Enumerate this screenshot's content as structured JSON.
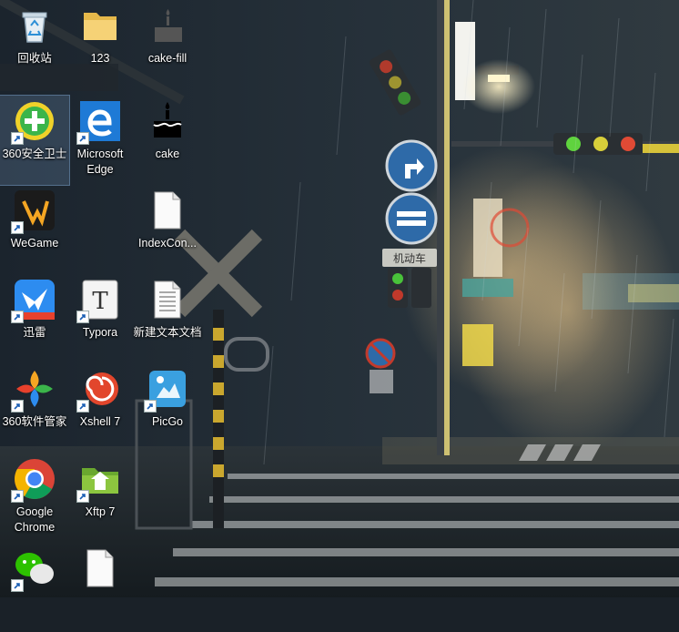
{
  "desktop": {
    "icons": [
      {
        "label": "回收站",
        "icon": "recycle-bin-icon"
      },
      {
        "label": "123",
        "icon": "folder-icon"
      },
      {
        "label": "cake-fill",
        "icon": "cake-fill-icon"
      },
      {
        "label": "360安全卫士",
        "icon": "360-security-icon"
      },
      {
        "label": "Microsoft Edge",
        "icon": "edge-icon"
      },
      {
        "label": "cake",
        "icon": "cake-icon"
      },
      {
        "label": "WeGame",
        "icon": "wegame-icon"
      },
      {
        "label": "IndexCon...",
        "icon": "blank-file-icon"
      },
      {
        "label": "迅雷",
        "icon": "xunlei-icon"
      },
      {
        "label": "Typora",
        "icon": "typora-icon"
      },
      {
        "label": "新建文本文档",
        "icon": "text-file-icon"
      },
      {
        "label": "360软件管家",
        "icon": "360-software-manager-icon"
      },
      {
        "label": "Xshell 7",
        "icon": "xshell-icon"
      },
      {
        "label": "PicGo",
        "icon": "picgo-icon"
      },
      {
        "label": "Google Chrome",
        "icon": "chrome-icon"
      },
      {
        "label": "Xftp 7",
        "icon": "xftp-icon"
      },
      {
        "label": "",
        "icon": "wechat-icon"
      },
      {
        "label": "",
        "icon": "blank-file-icon"
      }
    ]
  },
  "wallpaper": {
    "sign_text": "机动车",
    "colors": {
      "sky": "#1d2630",
      "lamp": "#f6e6b0",
      "green": "#49c23a",
      "red": "#e83a2a",
      "yellow": "#d9c62a"
    }
  }
}
